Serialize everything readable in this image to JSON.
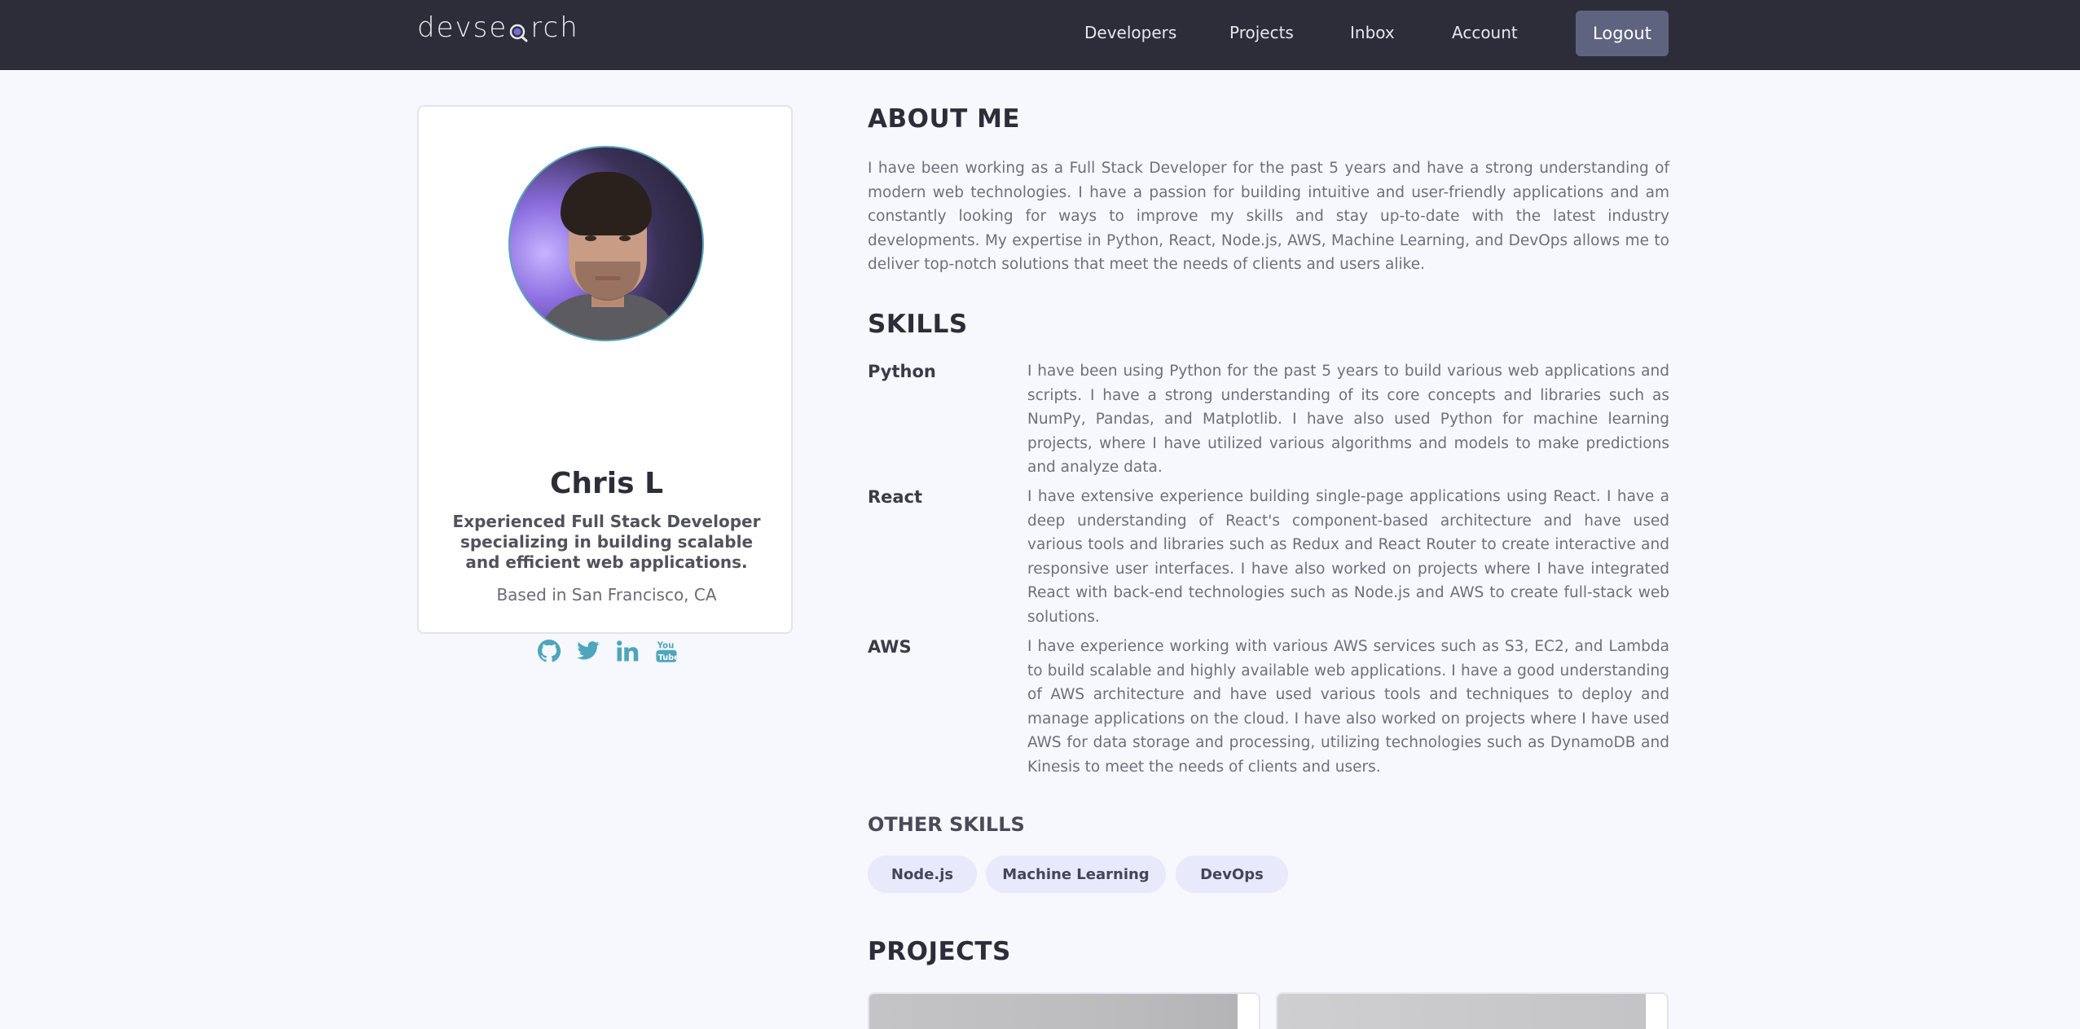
{
  "header": {
    "logo_text_before": "devse",
    "logo_text_after": "rch",
    "nav": [
      "Developers",
      "Projects",
      "Inbox",
      "Account"
    ],
    "logout_label": "Logout"
  },
  "profile": {
    "name": "Chris L",
    "tagline": "Experienced Full Stack Developer specializing in building scalable and efficient web applications.",
    "location": "Based in San Francisco, CA",
    "socials": [
      "github-icon",
      "twitter-icon",
      "linkedin-icon",
      "youtube-icon"
    ],
    "social_color": "#4ea6bc"
  },
  "about": {
    "title": "ABOUT ME",
    "text": "I have been working as a Full Stack Developer for the past 5 years and have a strong understanding of modern web technologies. I have a passion for building intuitive and user-friendly applications and am constantly looking for ways to improve my skills and stay up-to-date with the latest industry developments. My expertise in Python, React, Node.js, AWS, Machine Learning, and DevOps allows me to deliver top-notch solutions that meet the needs of clients and users alike."
  },
  "skills": {
    "title": "SKILLS",
    "items": [
      {
        "name": "Python",
        "description": "I have been using Python for the past 5 years to build various web applications and scripts. I have a strong understanding of its core concepts and libraries such as NumPy, Pandas, and Matplotlib. I have also used Python for machine learning projects, where I have utilized various algorithms and models to make predictions and analyze data."
      },
      {
        "name": "React",
        "description": "I have extensive experience building single-page applications using React. I have a deep understanding of React's component-based architecture and have used various tools and libraries such as Redux and React Router to create interactive and responsive user interfaces. I have also worked on projects where I have integrated React with back-end technologies such as Node.js and AWS to create full-stack web solutions."
      },
      {
        "name": "AWS",
        "description": "I have experience working with various AWS services such as S3, EC2, and Lambda to build scalable and highly available web applications. I have a good understanding of AWS architecture and have used various tools and techniques to deploy and manage applications on the cloud. I have also worked on projects where I have used AWS for data storage and processing, utilizing technologies such as DynamoDB and Kinesis to meet the needs of clients and users."
      }
    ]
  },
  "other_skills": {
    "title": "OTHER SKILLS",
    "tags": [
      "Node.js",
      "Machine Learning",
      "DevOps"
    ]
  },
  "projects": {
    "title": "PROJECTS"
  },
  "colors": {
    "header_bg": "#2d2d39",
    "page_bg": "#f6f8fd",
    "accent": "#4ea6bc",
    "button_bg": "#5e6380",
    "tag_bg": "#e8e9fb"
  }
}
